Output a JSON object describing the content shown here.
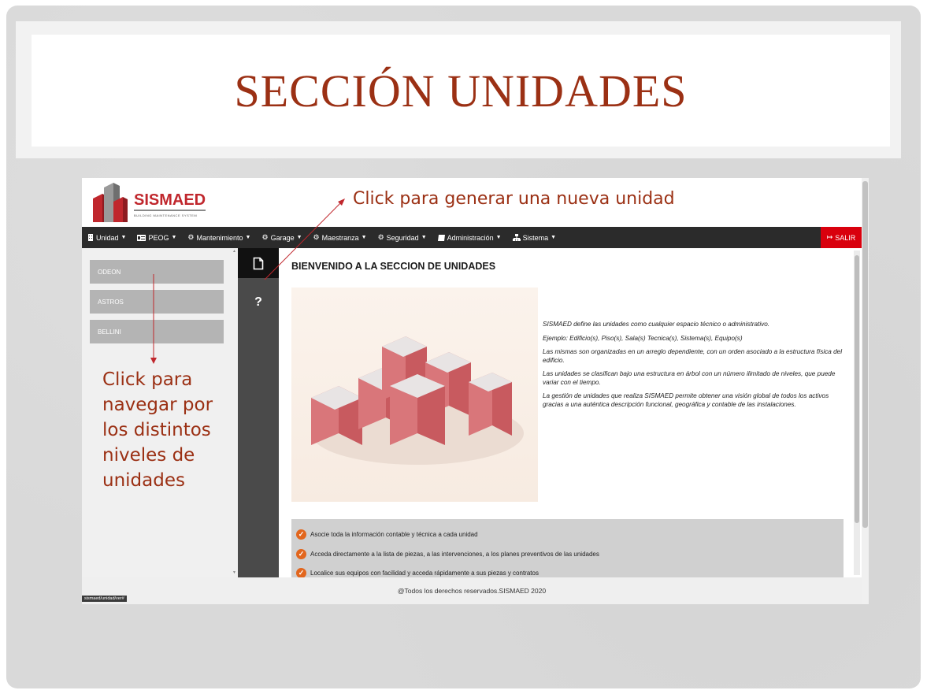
{
  "slide": {
    "title": "SECCIÓN UNIDADES",
    "annotation_new": "Click para generar una nueva unidad",
    "annotation_nav": "Click para navegar por los distintos niveles de unidades",
    "accent_color": "#9b3014"
  },
  "app": {
    "logo_text": "SISMAED",
    "logo_subtitle": "BUILDING MAINTENANCE SYSTEM",
    "nav": [
      {
        "label": "Unidad",
        "icon": "building-icon"
      },
      {
        "label": "PEOG",
        "icon": "id-card-icon"
      },
      {
        "label": "Mantenimiento",
        "icon": "cogs-icon"
      },
      {
        "label": "Garage",
        "icon": "cogs-icon"
      },
      {
        "label": "Maestranza",
        "icon": "cogs-icon"
      },
      {
        "label": "Seguridad",
        "icon": "cogs-icon"
      },
      {
        "label": "Administración",
        "icon": "book-icon"
      },
      {
        "label": "Sistema",
        "icon": "sitemap-icon"
      }
    ],
    "logout_label": "SALIR",
    "sidebar_items": [
      "ODEON",
      "ASTROS",
      "BELLINI"
    ],
    "tools": [
      {
        "icon": "new-document-icon"
      },
      {
        "icon": "help-icon",
        "glyph": "?"
      }
    ],
    "heading": "BIENVENIDO A LA SECCION DE UNIDADES",
    "description": [
      "SISMAED define las unidades como cualquier espacio técnico o administrativo.",
      "Ejemplo: Edificio(s), Piso(s), Sala(s) Tecnica(s), Sistema(s), Equipo(s)",
      "Las mismas son organizadas en un arreglo dependiente, con un orden asociado a la estructura física del edificio.",
      "Las unidades se clasifican bajo una estructura en árbol con un número ilimitado de niveles, que puede variar con el tiempo.",
      "La gestión de unidades que realiza SISMAED permite obtener una visión global de todos los activos gracias a una auténtica descripción funcional, geográfica y contable de las instalaciones."
    ],
    "features": [
      "Asocie toda la información contable y técnica a cada unidad",
      "Acceda directamente a la lista de piezas, a las intervenciones, a los planes preventivos de las unidades",
      "Localice sus equipos con facilidad y acceda rápidamente a sus piezas y contratos"
    ],
    "footer": "@Todos los derechos reservados.SISMAED 2020",
    "status_url": "sismaed/unidad/ver#",
    "brand_color": "#c0272d",
    "logout_color": "#d9000d",
    "feature_check_color": "#e2661d"
  }
}
